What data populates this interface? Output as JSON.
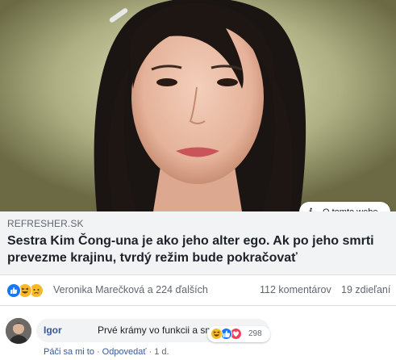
{
  "link_preview": {
    "about_button_label": "O tomto webe",
    "domain": "REFRESHER.SK",
    "title": "Sestra Kim Čong-una je ako jeho alter ego. Ak po jeho smrti prevezme krajinu, tvrdý režim bude pokračovať"
  },
  "reactions": {
    "icons": [
      "like-icon",
      "haha-icon",
      "sad-icon"
    ],
    "names_text": "Veronika Marečková a 224 ďalších",
    "comments_text": "112 komentárov",
    "shares_text": "19 zdieľaní",
    "colors": {
      "like": "#1877f2",
      "haha": "#f7b928",
      "love": "#f33e58"
    }
  },
  "comment": {
    "author": "Igor",
    "text": "Prvé krámy vo funkcii a sme hotoví",
    "reaction_icons": [
      "haha-icon",
      "like-icon",
      "love-icon"
    ],
    "reaction_count": "298",
    "actions": {
      "like": "Páči sa mi to",
      "reply": "Odpovedať",
      "time": "1 d."
    }
  }
}
